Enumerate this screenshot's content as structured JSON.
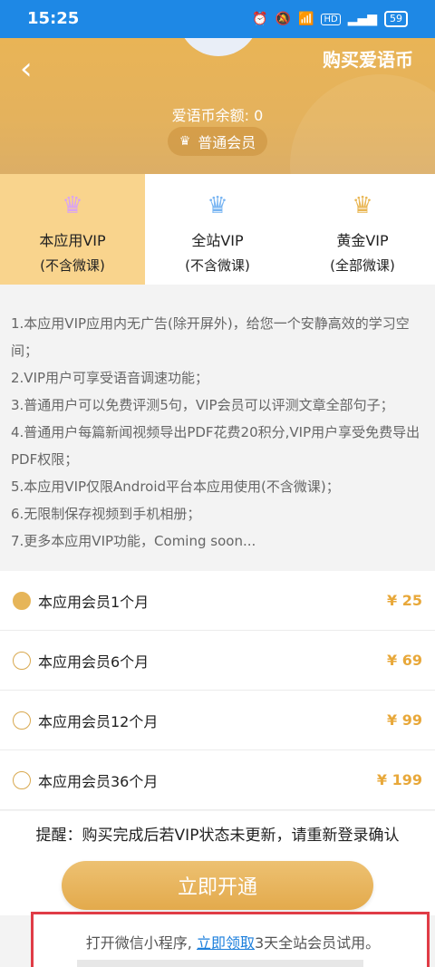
{
  "status_bar": {
    "time": "15:25",
    "battery": "59"
  },
  "header": {
    "buy_coin": "购买爱语币",
    "balance": "爱语币余额: 0",
    "member_level": "普通会员"
  },
  "tabs": [
    {
      "title": "本应用VIP",
      "sub": "(不含微课)",
      "icon": "crown-pink-icon",
      "active": true
    },
    {
      "title": "全站VIP",
      "sub": "(不含微课)",
      "icon": "crown-blue-icon",
      "active": false
    },
    {
      "title": "黄金VIP",
      "sub": "(全部微课)",
      "icon": "crown-gold-icon",
      "active": false
    }
  ],
  "description": [
    "1.本应用VIP应用内无广告(除开屏外)，给您一个安静高效的学习空间；",
    "2.VIP用户可享受语音调速功能；",
    "3.普通用户可以免费评测5句，VIP会员可以评测文章全部句子；",
    "4.普通用户每篇新闻视频导出PDF花费20积分,VIP用户享受免费导出PDF权限；",
    "5.本应用VIP仅限Android平台本应用使用(不含微课)；",
    "6.无限制保存视频到手机相册；",
    "7.更多本应用VIP功能，Coming soon..."
  ],
  "plans": [
    {
      "name": "本应用会员1个月",
      "price": "¥ 25",
      "selected": true
    },
    {
      "name": "本应用会员6个月",
      "price": "¥ 69",
      "selected": false
    },
    {
      "name": "本应用会员12个月",
      "price": "¥ 99",
      "selected": false
    },
    {
      "name": "本应用会员36个月",
      "price": "¥ 199",
      "selected": false
    }
  ],
  "reminder": "提醒：购买完成后若VIP状态未更新，请重新登录确认",
  "cta": "立即开通",
  "trial": {
    "prefix": "打开微信小程序, ",
    "link": "立即领取",
    "suffix": "3天全站会员试用。"
  },
  "colors": {
    "accent_gold": "#e6b559",
    "status_bar": "#1e88e5",
    "link_blue": "#1c7fdc",
    "highlight_red": "#e03c46"
  }
}
